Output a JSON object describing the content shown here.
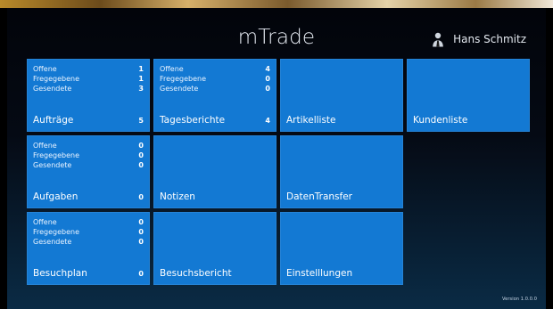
{
  "header": {
    "app_title": "mTrade",
    "user_name": "Hans Schmitz"
  },
  "tiles": [
    {
      "title": "Aufträge",
      "count": "5",
      "stats": [
        {
          "label": "Offene",
          "value": "1"
        },
        {
          "label": "Fregegebene",
          "value": "1"
        },
        {
          "label": "Gesendete",
          "value": "3"
        }
      ]
    },
    {
      "title": "Tagesberichte",
      "count": "4",
      "stats": [
        {
          "label": "Offene",
          "value": "4"
        },
        {
          "label": "Fregegebene",
          "value": "0"
        },
        {
          "label": "Gesendete",
          "value": "0"
        }
      ]
    },
    {
      "title": "Artikelliste"
    },
    {
      "title": "Kundenliste"
    },
    {
      "title": "Aufgaben",
      "count": "0",
      "stats": [
        {
          "label": "Offene",
          "value": "0"
        },
        {
          "label": "Fregegebene",
          "value": "0"
        },
        {
          "label": "Gesendete",
          "value": "0"
        }
      ]
    },
    {
      "title": "Notizen"
    },
    {
      "title": "DatenTransfer"
    },
    {
      "title": "Besuchplan",
      "count": "0",
      "stats": [
        {
          "label": "Offene",
          "value": "0"
        },
        {
          "label": "Fregegebene",
          "value": "0"
        },
        {
          "label": "Gesendete",
          "value": "0"
        }
      ]
    },
    {
      "title": "Besuchsbericht"
    },
    {
      "title": "Einstelllungen"
    }
  ],
  "footer": {
    "version": "Version 1.0.0.0"
  },
  "colors": {
    "tile": "#1379d3",
    "background_top": "#02040a",
    "background_bottom": "#0a2b45"
  },
  "icons": {
    "user_avatar": "user-avatar-icon"
  }
}
